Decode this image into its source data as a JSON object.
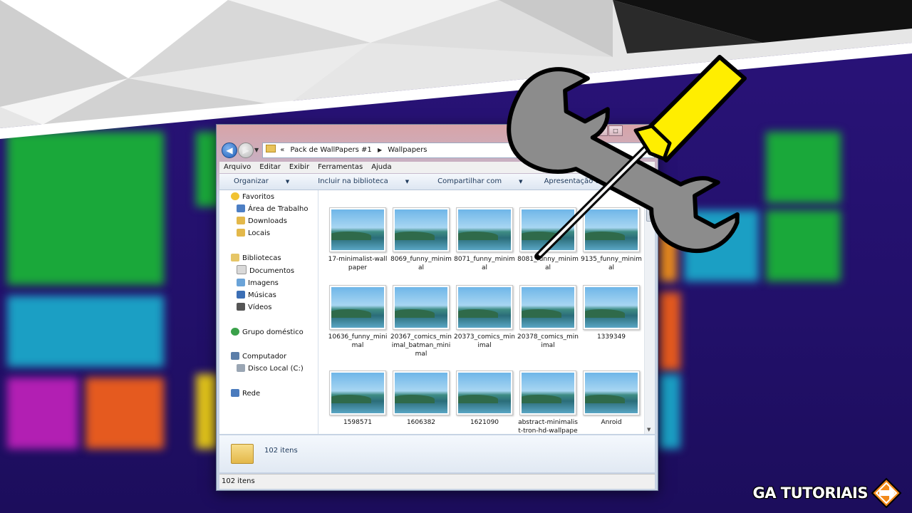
{
  "window": {
    "address": {
      "history_glyph": "«",
      "parts": [
        "Pack de WallPapers #1",
        "Wallpapers"
      ]
    },
    "menu": [
      "Arquivo",
      "Editar",
      "Exibir",
      "Ferramentas",
      "Ajuda"
    ],
    "commands": [
      "Organizar",
      "Incluir na biblioteca",
      "Compartilhar com",
      "Apresentação de slides",
      "»"
    ],
    "nav": {
      "favorites": "Favoritos",
      "favorites_items": [
        "Área de Trabalho",
        "Downloads",
        "Locais"
      ],
      "libraries": "Bibliotecas",
      "libraries_items": [
        "Documentos",
        "Imagens",
        "Músicas",
        "Vídeos"
      ],
      "homegroup": "Grupo doméstico",
      "computer": "Computador",
      "computer_items": [
        "Disco Local (C:)"
      ],
      "network": "Rede"
    },
    "files": [
      "17-minimalist-wallpaper",
      "8069_funny_minimal",
      "8071_funny_minimal",
      "8081_funny_minimal",
      "9135_funny_minimal",
      "10636_funny_minimal",
      "20367_comics_minimal_batman_minimal",
      "20373_comics_minimal",
      "20378_comics_minimal",
      "1339349",
      "1598571",
      "1606382",
      "1621090",
      "abstract-minimalist-tron-hd-wallpaper",
      "Anroid"
    ],
    "details_count": "102 itens",
    "status": "102 itens"
  },
  "logo": {
    "text": "GA TUTORIAIS"
  },
  "colors": {
    "background_purple": "#22106a",
    "tile_green": "#1aa83a",
    "tile_teal": "#1b9fc4",
    "tile_magenta": "#b21fb3",
    "tile_orange": "#e55a1f",
    "logo_orange": "#f28a1a",
    "screwdriver_yellow": "#ffee00",
    "wrench_gray": "#8c8c8c"
  }
}
